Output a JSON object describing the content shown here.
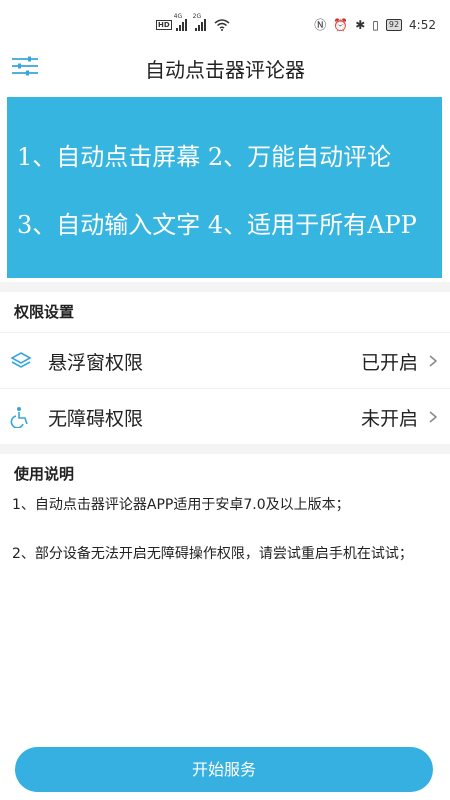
{
  "status_bar": {
    "hd_badge": "HD",
    "net1": "4G",
    "net2": "2G",
    "battery": "92",
    "time": "4:52"
  },
  "header": {
    "title": "自动点击器评论器",
    "menu_icon": "sliders-menu-icon"
  },
  "banner": {
    "line1": "1、自动点击屏幕  2、万能自动评论",
    "line2": "3、自动输入文字  4、适用于所有APP",
    "bg_color": "#35b5e0"
  },
  "permissions": {
    "title": "权限设置",
    "items": [
      {
        "label": "悬浮窗权限",
        "status": "已开启",
        "icon": "layers-icon"
      },
      {
        "label": "无障碍权限",
        "status": "未开启",
        "icon": "accessibility-icon"
      }
    ]
  },
  "instructions": {
    "title": "使用说明",
    "items": [
      "1、自动点击器评论器APP适用于安卓7.0及以上版本；",
      "2、部分设备无法开启无障碍操作权限，请尝试重启手机在试试；"
    ]
  },
  "actions": {
    "start_label": "开始服务",
    "button_color": "#35b0e0"
  }
}
